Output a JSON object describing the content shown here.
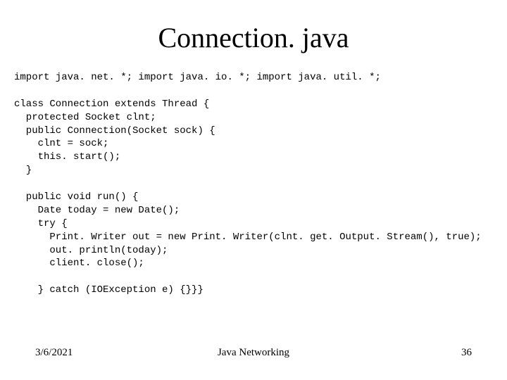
{
  "title": "Connection. java",
  "code": "import java. net. *; import java. io. *; import java. util. *;\n\nclass Connection extends Thread {\n  protected Socket clnt;\n  public Connection(Socket sock) {\n    clnt = sock;\n    this. start();\n  }\n\n  public void run() {\n    Date today = new Date();\n    try {\n      Print. Writer out = new Print. Writer(clnt. get. Output. Stream(), true);\n      out. println(today);\n      client. close();\n\n    } catch (IOException e) {}}}",
  "footer": {
    "date": "3/6/2021",
    "title": "Java Networking",
    "page": "36"
  }
}
